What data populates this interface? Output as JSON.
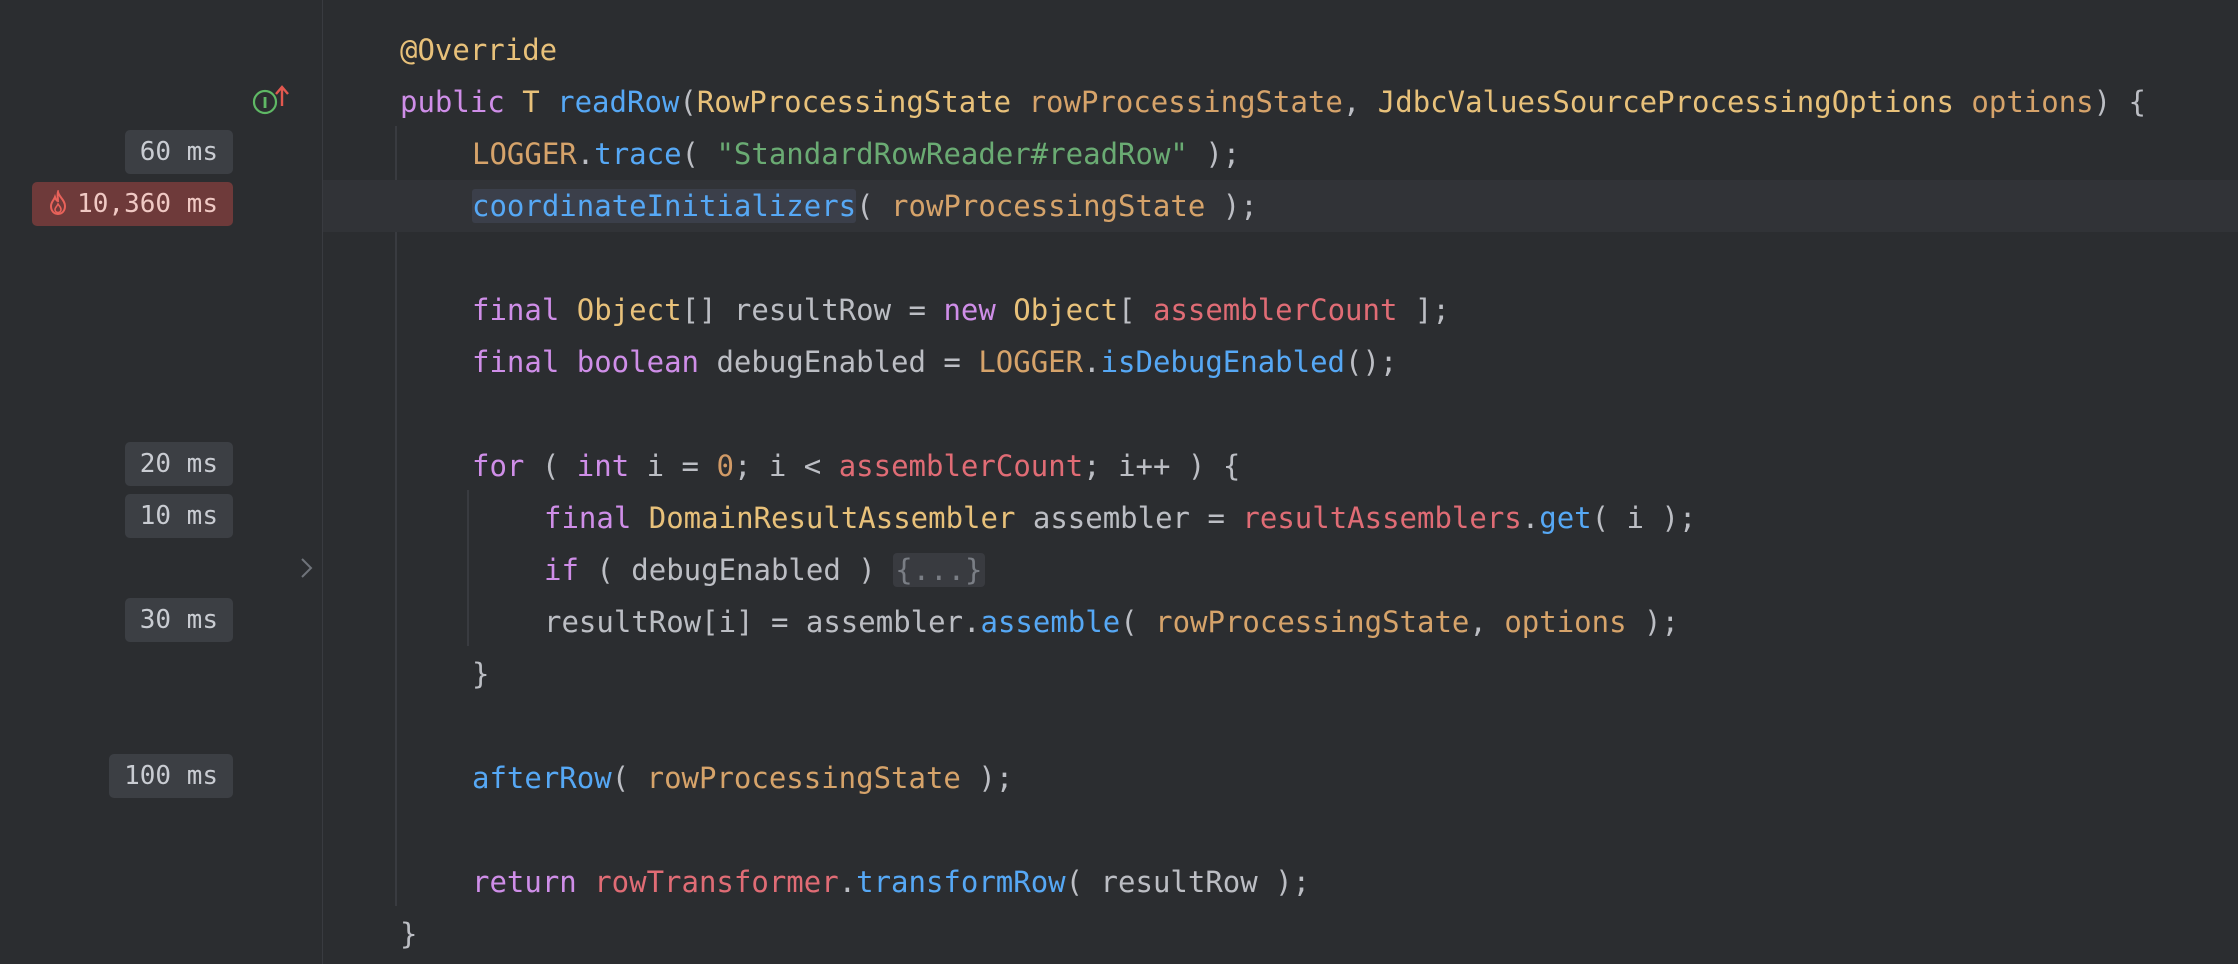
{
  "gutter": {
    "timings": [
      {
        "label": "60 ms"
      },
      {
        "label": "10,360 ms",
        "hot": true
      },
      {
        "label": "20 ms"
      },
      {
        "label": "10 ms"
      },
      {
        "label": "30 ms"
      },
      {
        "label": "100 ms"
      }
    ]
  },
  "code": {
    "l1": {
      "ann": "@Override"
    },
    "l2": {
      "kw_public": "public ",
      "t": "T ",
      "name": "readRow",
      "p1": "(",
      "type1": "RowProcessingState",
      "sp1": " ",
      "param1": "rowProcessingState",
      "comma": ", ",
      "type2": "JdbcValuesSourceProcessingOptions",
      "sp2": " ",
      "param2": "options",
      "end": ") {"
    },
    "l3": {
      "logger": "LOGGER",
      "dot": ".",
      "fn": "trace",
      "open": "( ",
      "str": "\"StandardRowReader#readRow\"",
      "close": " );"
    },
    "l4": {
      "fn": "coordinateInitializers",
      "open": "( ",
      "param": "rowProcessingState",
      "close": " );"
    },
    "l5": {
      "kw": "final ",
      "type": "Object",
      "t1": "[] resultRow = ",
      "kw2": "new ",
      "type2": "Object",
      "t2": "[ ",
      "field": "assemblerCount",
      "t3": " ];"
    },
    "l6": {
      "kw": "final ",
      "kw2": "boolean",
      "t1": " debugEnabled = ",
      "logger": "LOGGER",
      "dot": ".",
      "fn": "isDebugEnabled",
      "t2": "();"
    },
    "l7": {
      "kw": "for",
      "t1": " ( ",
      "kw2": "int",
      "t2": " i = ",
      "num": "0",
      "t3": "; i < ",
      "field": "assemblerCount",
      "t4": "; i++ ) {"
    },
    "l8": {
      "kw": "final ",
      "type": "DomainResultAssembler",
      "t1": " assembler = ",
      "field": "resultAssemblers",
      "dot": ".",
      "fn": "get",
      "t2": "( i );"
    },
    "l9": {
      "kw": "if",
      "t1": " ( debugEnabled ) ",
      "fold": "{...}"
    },
    "l10": {
      "t1": "resultRow[i] = assembler.",
      "fn": "assemble",
      "t2": "( ",
      "param1": "rowProcessingState",
      "comma": ", ",
      "param2": "options",
      "t3": " );"
    },
    "l11": {
      "t": "}"
    },
    "l12": {
      "fn": "afterRow",
      "t1": "( ",
      "param": "rowProcessingState",
      "t2": " );"
    },
    "l13": {
      "kw": "return ",
      "field": "rowTransformer",
      "dot": ".",
      "fn": "transformRow",
      "t1": "( resultRow );"
    },
    "l14": {
      "t": "}"
    }
  },
  "icons": [
    "implementation-icon",
    "fold-arrow-icon",
    "flame-icon"
  ],
  "colors": {
    "background": "#2b2d30",
    "keyword": "#cf8ee8",
    "type": "#e8c17a",
    "function": "#56a8f5",
    "parameter": "#d6a36a",
    "field": "#e06c75",
    "string": "#6aab73",
    "hot_badge": "#6e3a3a"
  }
}
